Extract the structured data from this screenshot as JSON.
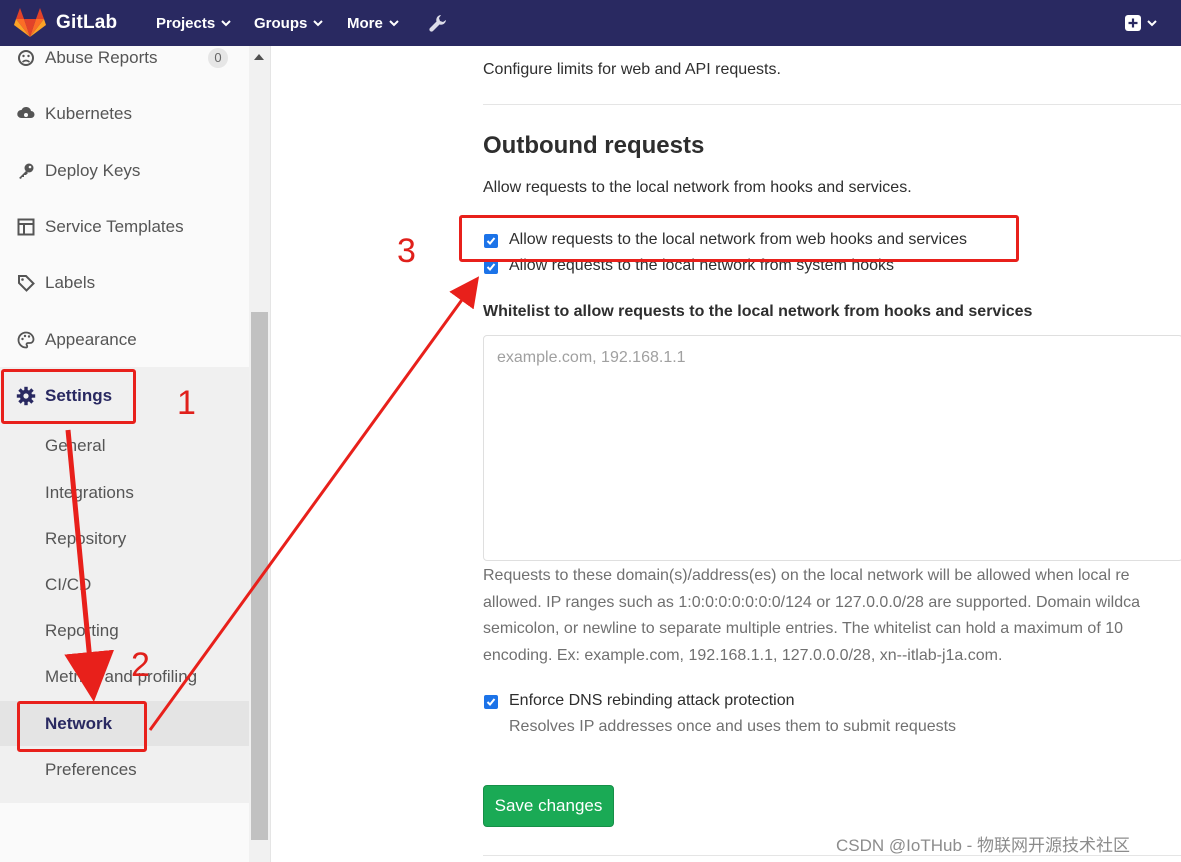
{
  "navbar": {
    "brand": "GitLab",
    "items": [
      {
        "label": "Projects"
      },
      {
        "label": "Groups"
      },
      {
        "label": "More"
      }
    ]
  },
  "sidebar": {
    "items": [
      {
        "label": "Abuse Reports",
        "icon": "abuse-icon",
        "badge": "0"
      },
      {
        "label": "Kubernetes",
        "icon": "kubernetes-icon"
      },
      {
        "label": "Deploy Keys",
        "icon": "key-icon"
      },
      {
        "label": "Service Templates",
        "icon": "template-icon"
      },
      {
        "label": "Labels",
        "icon": "label-icon"
      },
      {
        "label": "Appearance",
        "icon": "palette-icon"
      },
      {
        "label": "Settings",
        "icon": "gear-icon"
      }
    ],
    "settings_sub": [
      "General",
      "Integrations",
      "Repository",
      "CI/CD",
      "Reporting",
      "Metrics and profiling",
      "Network",
      "Preferences"
    ],
    "active_sub": "Network"
  },
  "main": {
    "intro": "Configure limits for web and API requests.",
    "section_title": "Outbound requests",
    "section_desc": "Allow requests to the local network from hooks and services.",
    "checkbox_web_hooks": "Allow requests to the local network from web hooks and services",
    "checkbox_system_hooks": "Allow requests to the local network from system hooks",
    "whitelist_label": "Whitelist to allow requests to the local network from hooks and services",
    "whitelist_placeholder": "example.com, 192.168.1.1",
    "help_lines": [
      "Requests to these domain(s)/address(es) on the local network will be allowed when local re",
      "allowed. IP ranges such as 1:0:0:0:0:0:0:0/124 or 127.0.0.0/28 are supported. Domain wildca",
      "semicolon, or newline to separate multiple entries. The whitelist can hold a maximum of 10",
      "encoding. Ex: example.com, 192.168.1.1, 127.0.0.0/28, xn--itlab-j1a.com."
    ],
    "dns_label": "Enforce DNS rebinding attack protection",
    "dns_help": "Resolves IP addresses once and uses them to submit requests",
    "save_label": "Save changes"
  },
  "annotations": {
    "step1": "1",
    "step2": "2",
    "step3": "3",
    "color": "#e8201b"
  },
  "colors": {
    "navbar": "#292961",
    "accent": "#1c73e8",
    "save": "#1aaa55"
  },
  "watermark": "CSDN @IoTHub - 物联网开源技术社区"
}
